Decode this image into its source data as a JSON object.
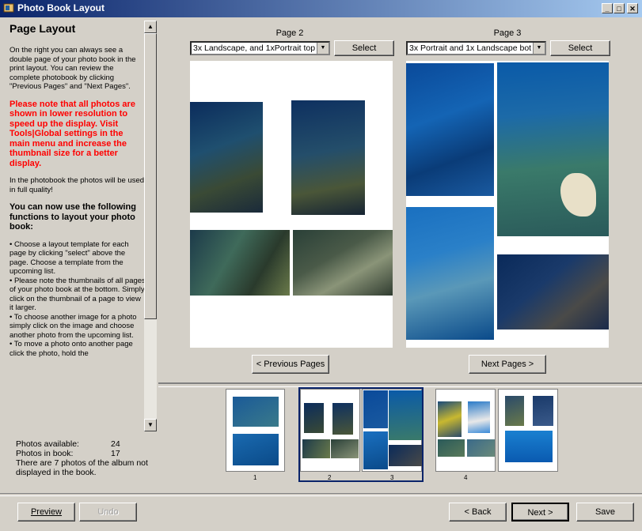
{
  "window": {
    "title": "Photo Book Layout",
    "buttons": {
      "minimize": "_",
      "maximize": "□",
      "close": "✕"
    }
  },
  "help": {
    "heading": "Page Layout",
    "p1": "On the right you can always see a double page of your photo book in the print layout. You can review the complete photobook by clicking \"Previous Pages\" and \"Next Pages\".",
    "p2": "Please note that all photos are shown in lower resolution to speed up the display. Visit Tools|Global settings in the main menu and increase the thumbnail size for a better display.",
    "p3": "In the photobook the photos will be used in full quality!",
    "p4": "You can now use the following functions to layout your photo book:",
    "p5": "• Choose a layout template for each page by clicking \"select\" above the page. Choose a template from the upcoming list.\n• Please note the thumbnails of all pages of your photo book at the bottom. Simply click on the thumbnail of a page to view it larger.\n• To choose another image for a photo simply click on the image and choose another photo from the upcoming list.\n• To move a photo onto another page click the photo, hold the"
  },
  "stats": {
    "available_label": "Photos available:",
    "available_value": "24",
    "inbook_label": "Photos in book:",
    "inbook_value": "17",
    "note": "There are 7 photos of the album not displayed in the book."
  },
  "pages": {
    "left": {
      "label": "Page 2",
      "template": "3x Landscape, and 1xPortrait top",
      "select": "Select"
    },
    "right": {
      "label": "Page 3",
      "template": "3x Portrait and 1x Landscape bot",
      "select": "Select"
    },
    "prev": "< Previous Pages",
    "next": "Next Pages >"
  },
  "thumbs": {
    "labels": [
      "1",
      "2",
      "3",
      "4"
    ]
  },
  "footer": {
    "preview": "Preview",
    "undo": "Undo",
    "back": "< Back",
    "next": "Next >",
    "save": "Save"
  },
  "colors": {
    "titlebar": "#0a246a",
    "warning": "#ff0000",
    "selection": "#0a246a"
  }
}
